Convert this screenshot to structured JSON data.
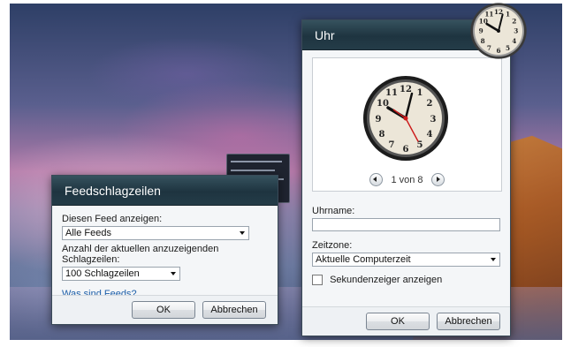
{
  "feed_dialog": {
    "title": "Feedschlagzeilen",
    "feed_label": "Diesen Feed anzeigen:",
    "feed_value": "Alle Feeds",
    "count_label": "Anzahl der aktuellen anzuzeigenden Schlagzeilen:",
    "count_value": "100 Schlagzeilen",
    "link": "Was sind Feeds?",
    "ok": "OK",
    "cancel": "Abbrechen"
  },
  "clock_dialog": {
    "title": "Uhr",
    "pager": "1 von 8",
    "name_label": "Uhrname:",
    "name_value": "",
    "tz_label": "Zeitzone:",
    "tz_value": "Aktuelle Computerzeit",
    "seconds_label": "Sekundenzeiger anzeigen",
    "seconds_checked": false,
    "ok": "OK",
    "cancel": "Abbrechen"
  },
  "icons": [
    "clock-gadget-icon",
    "feed-gadget-icon",
    "previous-icon",
    "next-icon",
    "dropdown-arrow-icon"
  ],
  "colors": {
    "titlebar": "#1e3440",
    "link": "#1c5ea8",
    "second_hand": "#cc1a1a"
  }
}
